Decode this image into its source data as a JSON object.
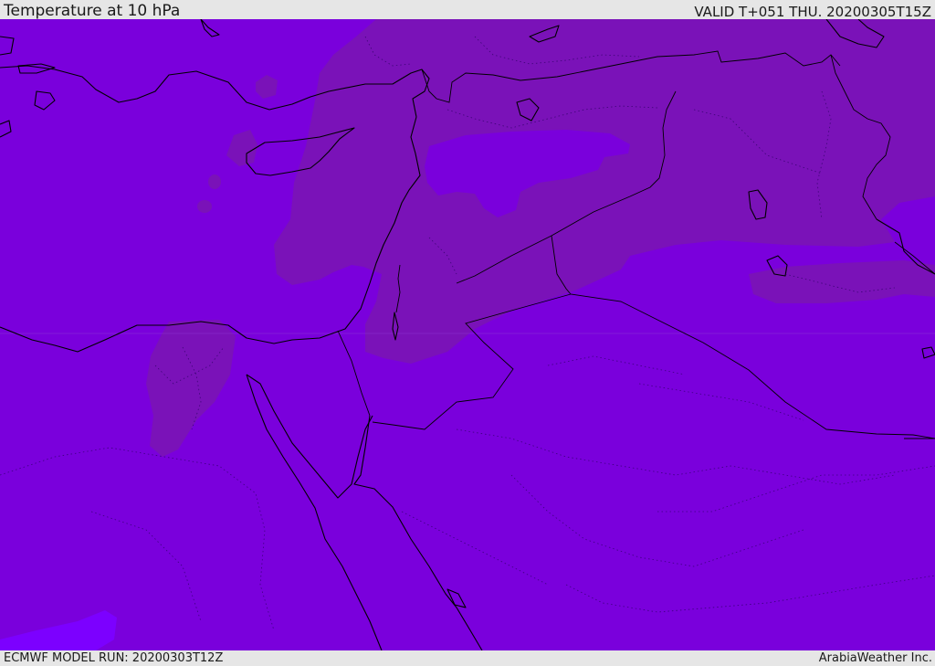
{
  "header": {
    "title": "Temperature at 10 hPa",
    "valid": "VALID T+051 THU. 20200305T15Z"
  },
  "footer": {
    "model_run": "ECMWF MODEL RUN: 20200303T12Z",
    "credit": "ArabiaWeather Inc."
  },
  "colors": {
    "base_field": "#7a00dc",
    "warmer_field": "#7a12b8",
    "cooler_field": "#7c00ff",
    "coastline": "#000000",
    "header_background": "#e6e6e6"
  }
}
